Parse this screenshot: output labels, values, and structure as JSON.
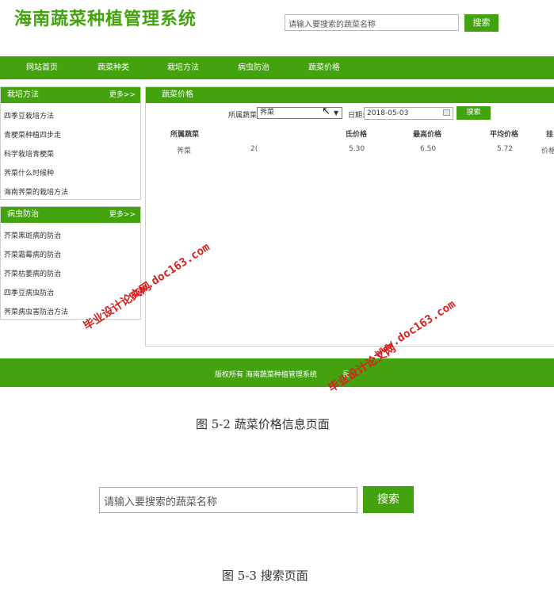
{
  "header": {
    "title": "海南蔬菜种植管理系统",
    "search_placeholder": "请输入要搜索的蔬菜名称",
    "search_button": "搜索"
  },
  "nav": [
    "网站首页",
    "蔬菜种类",
    "栽培方法",
    "病虫防治",
    "蔬菜价格"
  ],
  "sidebar": {
    "cultivation": {
      "title": "栽培方法",
      "more": "更多>>",
      "items": [
        "四季豆栽培方法",
        "青梗菜种植四步走",
        "科学栽培青梗菜",
        "荠菜什么时候种",
        "海南荠菜的栽培方法"
      ]
    },
    "pests": {
      "title": "病虫防治",
      "more": "更多>>",
      "items": [
        "芥菜黑斑病的防治",
        "芥菜霜霉病的防治",
        "芥菜枯萎病的防治",
        "四季豆病虫防治",
        "荠菜病虫害防治方法"
      ]
    }
  },
  "price_panel": {
    "title": "蔬菜价格",
    "filter_label": "所属蔬菜",
    "selected_vegetable": "荠菜",
    "date_label": "日期:",
    "date_value": "2018-05-03",
    "search_button": "搜索",
    "columns": [
      "所属蔬菜",
      "氐价格",
      "最高价格",
      "平均价格",
      "挂"
    ],
    "rows": [
      {
        "vegetable": "荠菜",
        "date_partial": "2(",
        "low": "5.30",
        "high": "6.50",
        "avg": "5.72",
        "extra": "价格"
      }
    ]
  },
  "footer": {
    "text": "版权所有 海南蔬菜种植管理系统",
    "text_tail": "录"
  },
  "watermark": {
    "line1": "毕业设计论文网",
    "line2": "www.doc163.com"
  },
  "captions": {
    "fig1": "图 5-2 蔬菜价格信息页面",
    "fig2": "图 5-3  搜索页面"
  },
  "search_screen": {
    "placeholder": "请输入要搜索的蔬菜名称",
    "button": "搜索"
  },
  "colors": {
    "brand_green": "#43a30f",
    "watermark_red": "#d82020"
  }
}
